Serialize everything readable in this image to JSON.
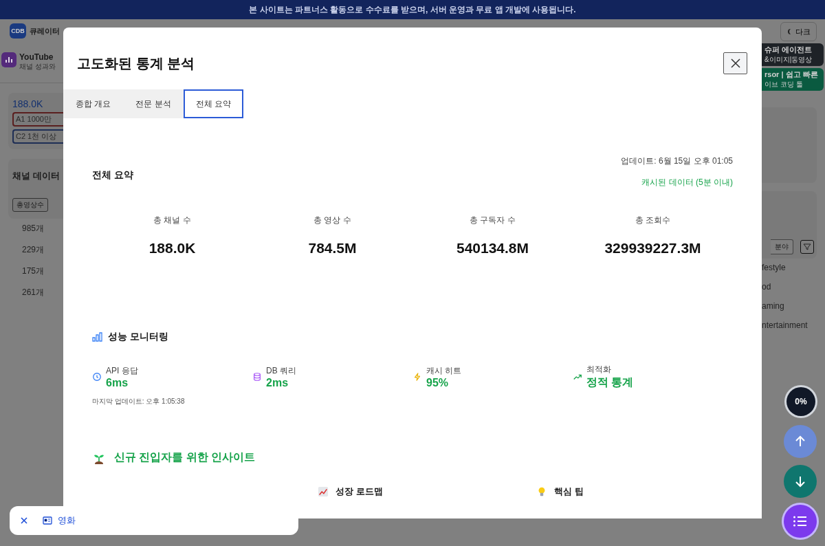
{
  "banner": {
    "text": "본 사이트는 파트너스 활동으로 수수료를 받으며, 서버 운영과 무료 앱 개발에 사용됩니다."
  },
  "header": {
    "logo": "CDB",
    "site_name": "큐레이터",
    "theme_button": "다크"
  },
  "left_panel": {
    "app_title": "YouTube",
    "app_subtitle": "채널 성과와",
    "total_count": "188.0K",
    "tags": [
      {
        "label": "A1 1000만",
        "color": "#5a1f1f"
      },
      {
        "label": "C2 1천 이상",
        "color": "#1e2e55"
      }
    ],
    "section_title": "채널 데이터",
    "sort_button": "총영상수",
    "rows": [
      "985개",
      "229개",
      "175개",
      "261개"
    ]
  },
  "right_panel": {
    "promos": [
      {
        "title": "슈퍼 에이전트",
        "subtitle": "&이미지|동영상",
        "color": "#1e2227"
      },
      {
        "title": "rsor | 쉽고 빠른",
        "subtitle": "이브 코딩 툴",
        "color": "#0a5a40"
      }
    ],
    "sort_button": "분야",
    "rows": [
      "festyle",
      "od",
      "aming",
      "ntertainment"
    ]
  },
  "modal": {
    "title": "고도화된 통계 분석",
    "tabs": [
      {
        "label": "종합 개요",
        "selected": false
      },
      {
        "label": "전문 분석",
        "selected": false
      },
      {
        "label": "전체 요약",
        "selected": true
      }
    ],
    "summary": {
      "title": "전체 요약",
      "updated": "업데이트: 6월 15일 오후 01:05",
      "cache_note": "캐시된 데이터 (5분 이내)",
      "stats": [
        {
          "label": "총 채널 수",
          "value": "188.0K"
        },
        {
          "label": "총 영상 수",
          "value": "784.5M"
        },
        {
          "label": "총 구독자 수",
          "value": "540134.8M"
        },
        {
          "label": "총 조회수",
          "value": "329939227.3M"
        }
      ]
    },
    "performance": {
      "title": "성능 모니터링",
      "metrics": [
        {
          "kind": "clock",
          "label": "API 응답",
          "value": "6ms"
        },
        {
          "kind": "database",
          "label": "DB 쿼리",
          "value": "2ms"
        },
        {
          "kind": "bolt",
          "label": "캐시 히트",
          "value": "95%"
        },
        {
          "kind": "trend",
          "label": "최적화",
          "value": "정적 통계"
        }
      ],
      "last_updated": "마지막 업데이트: 오후 1:05:38"
    },
    "insights": {
      "title": "신규 진입자를 위한 인사이트",
      "columns": [
        {
          "kind": "chart",
          "title": "성장 로드맵"
        },
        {
          "kind": "bulb",
          "title": "핵심 팁"
        }
      ]
    }
  },
  "progress_badge": "0%",
  "toast": {
    "chip": "영화"
  }
}
